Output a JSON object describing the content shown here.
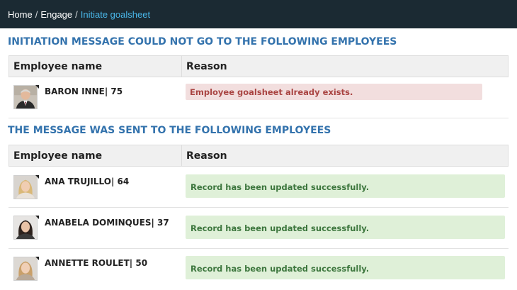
{
  "breadcrumb": {
    "items": [
      "Home",
      "Engage"
    ],
    "current": "Initiate goalsheet",
    "separator": "/"
  },
  "failed_section": {
    "title": "INITIATION MESSAGE COULD NOT GO TO THE FOLLOWING EMPLOYEES",
    "columns": [
      "Employee name",
      "Reason"
    ],
    "rows": [
      {
        "name": "BARON INNE| 75",
        "reason": "Employee goalsheet already exists.",
        "avatar_icon": "employee-photo-male"
      }
    ]
  },
  "sent_section": {
    "title": "THE MESSAGE WAS SENT TO THE FOLLOWING EMPLOYEES",
    "columns": [
      "Employee name",
      "Reason"
    ],
    "rows": [
      {
        "name": "ANA TRUJILLO| 64",
        "reason": "Record has been updated successfully.",
        "avatar_icon": "employee-photo-female"
      },
      {
        "name": "ANABELA DOMINQUES| 37",
        "reason": "Record has been updated successfully.",
        "avatar_icon": "employee-photo-female"
      },
      {
        "name": "ANNETTE ROULET| 50",
        "reason": "Record has been updated successfully.",
        "avatar_icon": "employee-photo-female"
      }
    ]
  },
  "colors": {
    "topbar": "#1b2a33",
    "breadcrumb_current": "#49b6e8",
    "section_title": "#3473ad",
    "error_bg": "#f2dede",
    "error_text": "#a94442",
    "success_bg": "#dff0d8",
    "success_text": "#3c763d"
  }
}
